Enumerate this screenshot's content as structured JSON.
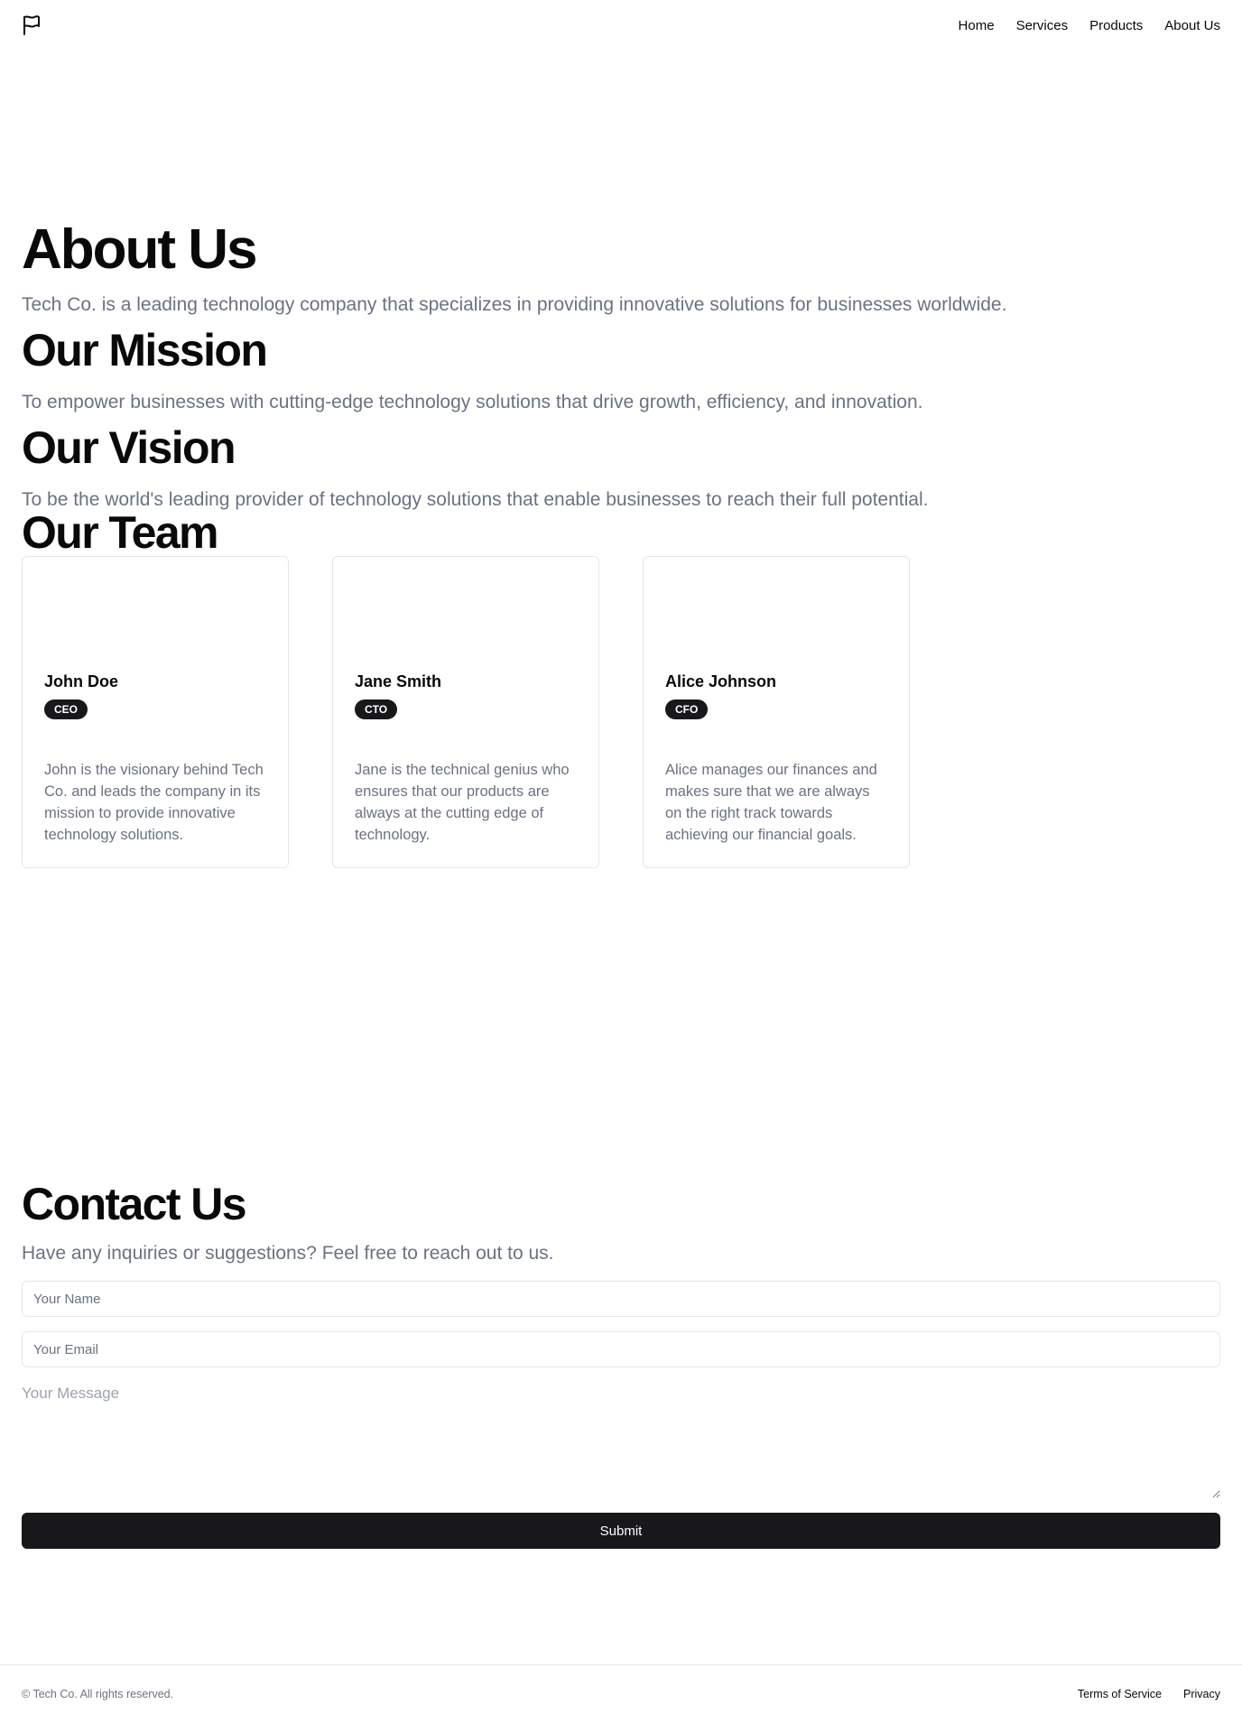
{
  "header": {
    "logo_icon": "flag-icon",
    "nav": [
      {
        "label": "Home"
      },
      {
        "label": "Services"
      },
      {
        "label": "Products"
      },
      {
        "label": "About Us"
      }
    ]
  },
  "about": {
    "title": "About Us",
    "intro": "Tech Co. is a leading technology company that specializes in providing innovative solutions for businesses worldwide."
  },
  "mission": {
    "title": "Our Mission",
    "text": "To empower businesses with cutting-edge technology solutions that drive growth, efficiency, and innovation."
  },
  "vision": {
    "title": "Our Vision",
    "text": "To be the world's leading provider of technology solutions that enable businesses to reach their full potential."
  },
  "team": {
    "title": "Our Team",
    "members": [
      {
        "name": "John Doe",
        "role": "CEO",
        "bio": "John is the visionary behind Tech Co. and leads the company in its mission to provide innovative technology solutions."
      },
      {
        "name": "Jane Smith",
        "role": "CTO",
        "bio": "Jane is the technical genius who ensures that our products are always at the cutting edge of technology."
      },
      {
        "name": "Alice Johnson",
        "role": "CFO",
        "bio": "Alice manages our finances and makes sure that we are always on the right track towards achieving our financial goals."
      }
    ]
  },
  "contact": {
    "title": "Contact Us",
    "intro": "Have any inquiries or suggestions? Feel free to reach out to us.",
    "name_placeholder": "Your Name",
    "email_placeholder": "Your Email",
    "message_placeholder": "Your Message",
    "submit_label": "Submit"
  },
  "footer": {
    "copyright": "© Tech Co. All rights reserved.",
    "links": [
      {
        "label": "Terms of Service"
      },
      {
        "label": "Privacy"
      }
    ]
  }
}
